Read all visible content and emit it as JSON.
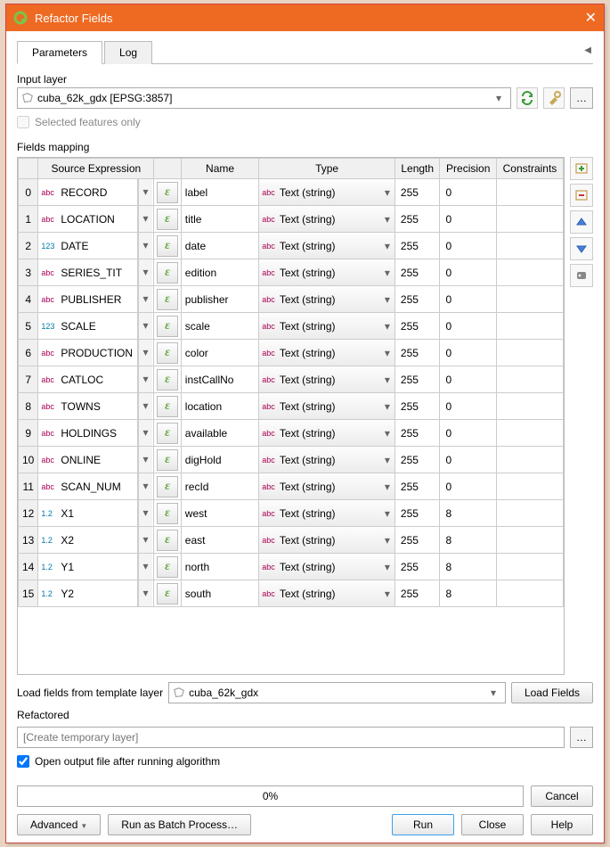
{
  "window": {
    "title": "Refactor Fields"
  },
  "tabs": {
    "parameters": "Parameters",
    "log": "Log"
  },
  "labels": {
    "input_layer": "Input layer",
    "selected_only": "Selected features only",
    "fields_mapping": "Fields mapping",
    "load_from": "Load fields from template layer",
    "refactored": "Refactored",
    "open_output": "Open output file after running algorithm"
  },
  "input_layer_value": "cuba_62k_gdx [EPSG:3857]",
  "template_layer_value": "cuba_62k_gdx",
  "output_placeholder": "[Create temporary layer]",
  "columns": {
    "source": "Source Expression",
    "name": "Name",
    "type": "Type",
    "length": "Length",
    "precision": "Precision",
    "constraints": "Constraints"
  },
  "rows": [
    {
      "idx": "0",
      "src": "RECORD",
      "src_kind": "abc",
      "name": "label",
      "type": "Text (string)",
      "len": "255",
      "prec": "0"
    },
    {
      "idx": "1",
      "src": "LOCATION",
      "src_kind": "abc",
      "name": "title",
      "type": "Text (string)",
      "len": "255",
      "prec": "0"
    },
    {
      "idx": "2",
      "src": "DATE",
      "src_kind": "123",
      "name": "date",
      "type": "Text (string)",
      "len": "255",
      "prec": "0"
    },
    {
      "idx": "3",
      "src": "SERIES_TIT",
      "src_kind": "abc",
      "name": "edition",
      "type": "Text (string)",
      "len": "255",
      "prec": "0"
    },
    {
      "idx": "4",
      "src": "PUBLISHER",
      "src_kind": "abc",
      "name": "publisher",
      "type": "Text (string)",
      "len": "255",
      "prec": "0"
    },
    {
      "idx": "5",
      "src": "SCALE",
      "src_kind": "123",
      "name": "scale",
      "type": "Text (string)",
      "len": "255",
      "prec": "0"
    },
    {
      "idx": "6",
      "src": "PRODUCTION",
      "src_kind": "abc",
      "name": "color",
      "type": "Text (string)",
      "len": "255",
      "prec": "0"
    },
    {
      "idx": "7",
      "src": "CATLOC",
      "src_kind": "abc",
      "name": "instCallNo",
      "type": "Text (string)",
      "len": "255",
      "prec": "0"
    },
    {
      "idx": "8",
      "src": "TOWNS",
      "src_kind": "abc",
      "name": "location",
      "type": "Text (string)",
      "len": "255",
      "prec": "0"
    },
    {
      "idx": "9",
      "src": "HOLDINGS",
      "src_kind": "abc",
      "name": "available",
      "type": "Text (string)",
      "len": "255",
      "prec": "0"
    },
    {
      "idx": "10",
      "src": "ONLINE",
      "src_kind": "abc",
      "name": "digHold",
      "type": "Text (string)",
      "len": "255",
      "prec": "0"
    },
    {
      "idx": "11",
      "src": "SCAN_NUM",
      "src_kind": "abc",
      "name": "recId",
      "type": "Text (string)",
      "len": "255",
      "prec": "0"
    },
    {
      "idx": "12",
      "src": "X1",
      "src_kind": "1.2",
      "name": "west",
      "type": "Text (string)",
      "len": "255",
      "prec": "8"
    },
    {
      "idx": "13",
      "src": "X2",
      "src_kind": "1.2",
      "name": "east",
      "type": "Text (string)",
      "len": "255",
      "prec": "8"
    },
    {
      "idx": "14",
      "src": "Y1",
      "src_kind": "1.2",
      "name": "north",
      "type": "Text (string)",
      "len": "255",
      "prec": "8"
    },
    {
      "idx": "15",
      "src": "Y2",
      "src_kind": "1.2",
      "name": "south",
      "type": "Text (string)",
      "len": "255",
      "prec": "8"
    }
  ],
  "progress": "0%",
  "buttons": {
    "load_fields": "Load Fields",
    "cancel": "Cancel",
    "advanced": "Advanced",
    "batch": "Run as Batch Process…",
    "run": "Run",
    "close": "Close",
    "help": "Help"
  }
}
